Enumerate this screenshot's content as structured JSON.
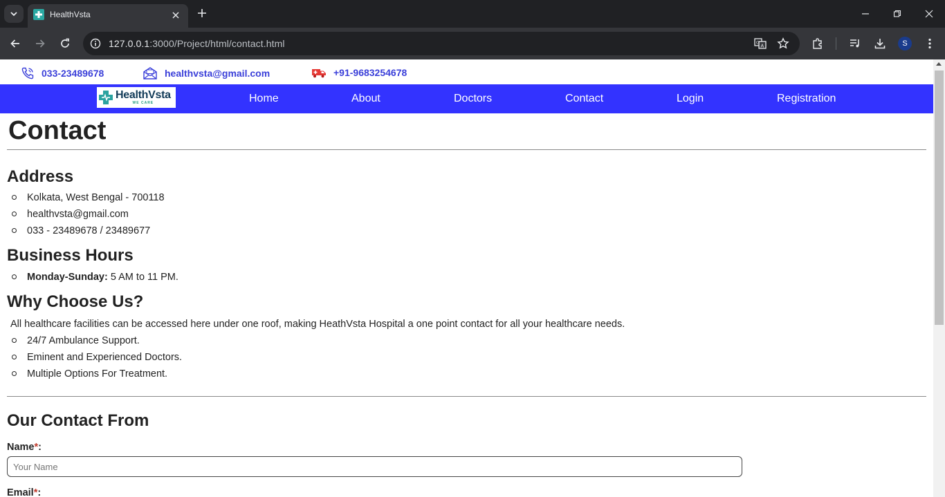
{
  "browser": {
    "tab_title": "HealthVsta",
    "url_host": "127.0.0.1",
    "url_rest": ":3000/Project/html/contact.html",
    "profile_initial": "S"
  },
  "topbar": {
    "phone": "033-23489678",
    "email": "healthvsta@gmail.com",
    "emergency": "+91-9683254678",
    "accent_color": "#3a3fd9"
  },
  "logo": {
    "name": "HealthVsta",
    "tagline": "WE CARE"
  },
  "nav": {
    "bg_color": "#3333ff",
    "items": [
      "Home",
      "About",
      "Doctors",
      "Contact",
      "Login",
      "Registration"
    ]
  },
  "page": {
    "title": "Contact",
    "address": {
      "heading": "Address",
      "items": [
        "Kolkata, West Bengal - 700118",
        "healthvsta@gmail.com",
        "033 - 23489678 / 23489677"
      ]
    },
    "hours": {
      "heading": "Business Hours",
      "label": "Monday-Sunday:",
      "value": " 5 AM to 11 PM."
    },
    "why": {
      "heading": "Why Choose Us?",
      "intro": "All healthcare facilities can be accessed here under one roof, making HeathVsta Hospital a one point contact for all your healthcare needs.",
      "items": [
        "24/7 Ambulance Support.",
        "Eminent and Experienced Doctors.",
        "Multiple Options For Treatment."
      ]
    },
    "form": {
      "heading": "Our Contact From",
      "name_label": "Name",
      "name_placeholder": "Your Name",
      "email_label": "Email",
      "required_mark": "*",
      "colon": ":"
    }
  }
}
